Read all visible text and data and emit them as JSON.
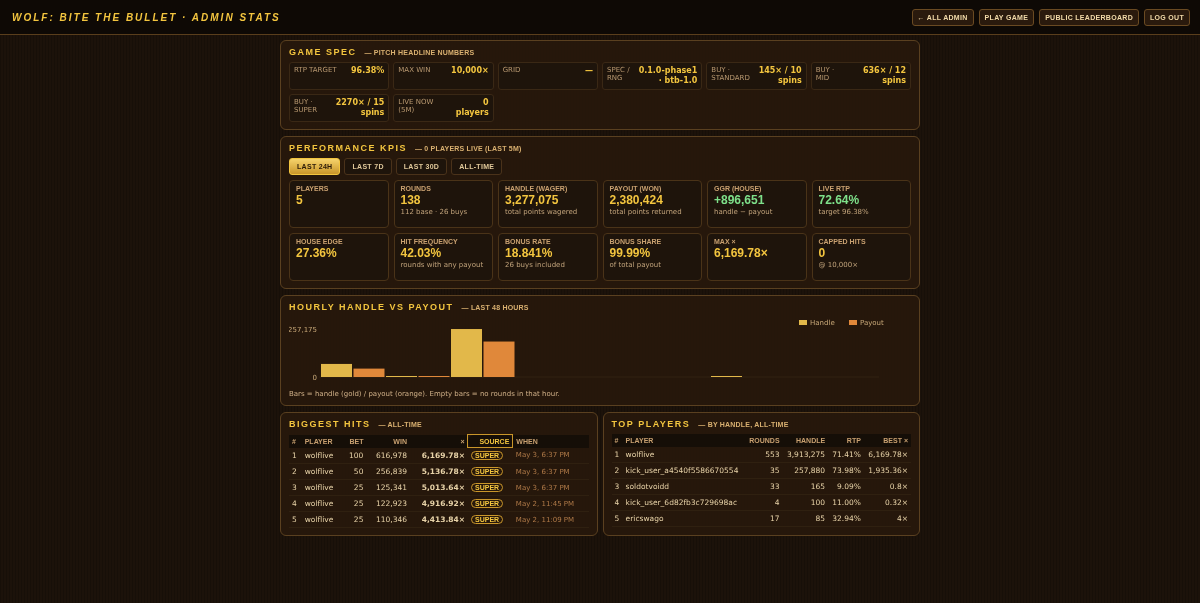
{
  "header": {
    "title": "WOLF: BITE THE BULLET · ADMIN STATS",
    "buttons": [
      {
        "label": "← ALL ADMIN"
      },
      {
        "label": "PLAY GAME"
      },
      {
        "label": "PUBLIC LEADERBOARD"
      },
      {
        "label": "LOG OUT"
      }
    ]
  },
  "game_spec": {
    "title": "GAME SPEC",
    "subtitle": "— PITCH HEADLINE NUMBERS",
    "items": [
      {
        "label": "RTP TARGET",
        "value": "96.38%"
      },
      {
        "label": "MAX WIN",
        "value": "10,000×"
      },
      {
        "label": "GRID",
        "value": "—"
      },
      {
        "label": "SPEC / RNG",
        "value": "0.1.0-phase1 · btb-1.0"
      },
      {
        "label": "BUY · STANDARD",
        "value": "145× / 10 spins"
      },
      {
        "label": "BUY · MID",
        "value": "636× / 12 spins"
      },
      {
        "label": "BUY · SUPER",
        "value": "2270× / 15 spins"
      },
      {
        "label": "LIVE NOW (5M)",
        "value": "0 players"
      }
    ]
  },
  "kpis": {
    "title": "PERFORMANCE KPIS",
    "subtitle": "— 0 PLAYERS LIVE (LAST 5M)",
    "tabs": [
      {
        "label": "LAST 24H",
        "selected": true
      },
      {
        "label": "LAST 7D",
        "selected": false
      },
      {
        "label": "LAST 30D",
        "selected": false
      },
      {
        "label": "ALL-TIME",
        "selected": false
      }
    ],
    "cards": [
      {
        "label": "PLAYERS",
        "value": "5",
        "kind": "plain"
      },
      {
        "label": "ROUNDS",
        "value": "138",
        "note": "112 base · 26 buys",
        "kind": "plain"
      },
      {
        "label": "HANDLE (WAGER)",
        "value": "3,277,075",
        "note": "total points wagered",
        "kind": "plain"
      },
      {
        "label": "PAYOUT (WON)",
        "value": "2,380,424",
        "note": "total points returned",
        "kind": "plain"
      },
      {
        "label": "GGR (HOUSE)",
        "value": "+896,651",
        "note": "handle − payout",
        "kind": "positive"
      },
      {
        "label": "LIVE RTP",
        "value": "72.64%",
        "note": "target 96.38%",
        "kind": "positive"
      },
      {
        "label": "HOUSE EDGE",
        "value": "27.36%",
        "kind": "plain"
      },
      {
        "label": "HIT FREQUENCY",
        "value": "42.03%",
        "note": "rounds with any payout",
        "kind": "plain"
      },
      {
        "label": "BONUS RATE",
        "value": "18.841%",
        "note": "26 buys included",
        "kind": "plain"
      },
      {
        "label": "BONUS SHARE",
        "value": "99.99%",
        "note": "of total payout",
        "kind": "plain"
      },
      {
        "label": "MAX ×",
        "value": "6,169.78×",
        "kind": "plain"
      },
      {
        "label": "CAPPED HITS",
        "value": "0",
        "note": "@ 10,000×",
        "kind": "plain"
      }
    ]
  },
  "hourly": {
    "title": "HOURLY HANDLE VS PAYOUT",
    "subtitle": "— LAST 48 HOURS",
    "chart_data": {
      "type": "bar",
      "stacked": false,
      "legend": true,
      "yticks": [
        {
          "value": 0,
          "label": "0"
        },
        {
          "value": 257175,
          "label": "257,175"
        }
      ],
      "ylim": [
        0,
        257175
      ],
      "series": [
        {
          "name": "Handle",
          "color": "#e2b84a",
          "values": [
            70000,
            3000,
            257000,
            0,
            0,
            0,
            2000,
            0,
            0
          ]
        },
        {
          "name": "Payout",
          "color": "#e0883a",
          "values": [
            45000,
            2000,
            190000,
            0,
            0,
            0,
            0,
            0,
            0
          ]
        }
      ]
    },
    "caption": "Bars = handle (gold) / payout (orange). Empty bars = no rounds in that hour."
  },
  "biggest_hits": {
    "title": "BIGGEST HITS",
    "subtitle": "— ALL-TIME",
    "columns": [
      "#",
      "PLAYER",
      "BET",
      "WIN",
      "×",
      "SOURCE",
      "WHEN"
    ],
    "rows": [
      [
        "1",
        "wolflive",
        "100",
        "616,978",
        "6,169.78×",
        "SUPER",
        "May 3, 6:37 PM"
      ],
      [
        "2",
        "wolflive",
        "50",
        "256,839",
        "5,136.78×",
        "SUPER",
        "May 3, 6:37 PM"
      ],
      [
        "3",
        "wolflive",
        "25",
        "125,341",
        "5,013.64×",
        "SUPER",
        "May 3, 6:37 PM"
      ],
      [
        "4",
        "wolflive",
        "25",
        "122,923",
        "4,916.92×",
        "SUPER",
        "May 2, 11:45 PM"
      ],
      [
        "5",
        "wolflive",
        "25",
        "110,346",
        "4,413.84×",
        "SUPER",
        "May 2, 11:09 PM"
      ]
    ]
  },
  "top_players": {
    "title": "TOP PLAYERS",
    "subtitle": "— BY HANDLE, ALL-TIME",
    "columns": [
      "#",
      "PLAYER",
      "ROUNDS",
      "HANDLE",
      "RTP",
      "BEST ×"
    ],
    "rows": [
      [
        "1",
        "wolflive",
        "553",
        "3,913,275",
        "71.41%",
        "6,169.78×"
      ],
      [
        "2",
        "kick_user_a4540f5586670554",
        "35",
        "257,880",
        "73.98%",
        "1,935.36×"
      ],
      [
        "3",
        "soldotvoidd",
        "33",
        "165",
        "9.09%",
        "0.8×"
      ],
      [
        "4",
        "kick_user_6d82fb3c729698ac",
        "4",
        "100",
        "11.00%",
        "0.32×"
      ],
      [
        "5",
        "ericswago",
        "17",
        "85",
        "32.94%",
        "4×"
      ]
    ]
  }
}
